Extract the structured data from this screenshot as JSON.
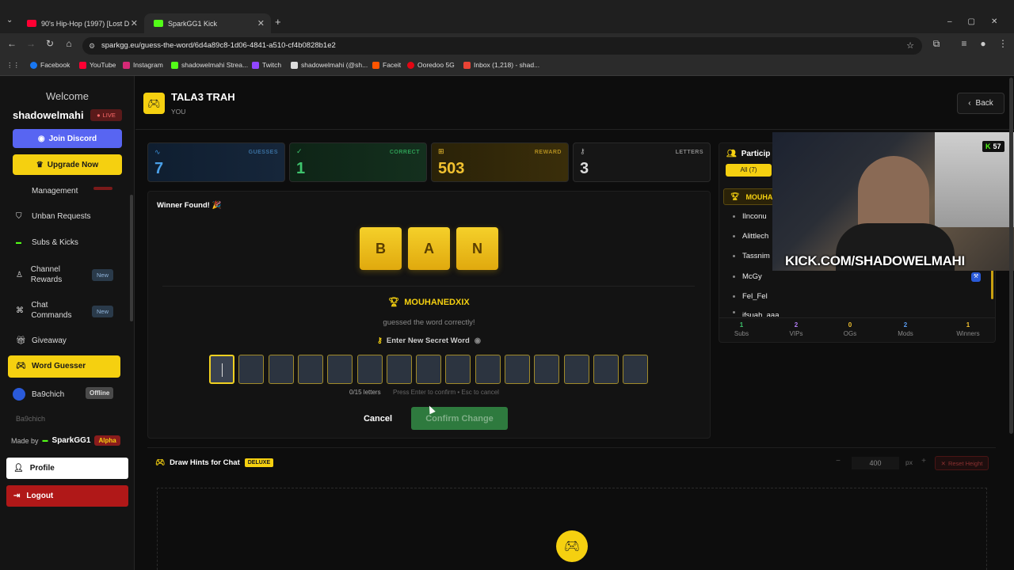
{
  "browser": {
    "tabs": [
      {
        "title": "90's Hip-Hop (1997) [Lost D",
        "active": false
      },
      {
        "title": "SparkGG1 Kick",
        "active": true
      }
    ],
    "url": "sparkgg.eu/guess-the-word/6d4a89c8-1d06-4841-a510-cf4b0828b1e2",
    "bookmarks": [
      "Facebook",
      "YouTube",
      "Instagram",
      "shadowelmahi Strea...",
      "Twitch",
      "shadowelmahi (@sh...",
      "Faceit",
      "Ooredoo 5G",
      "Inbox (1,218) - shad..."
    ]
  },
  "sidebar": {
    "welcome": "Welcome",
    "username": "shadowelmahi",
    "live_badge": "LIVE",
    "discord_button": "Join Discord",
    "upgrade_button": "Upgrade Now",
    "items": [
      {
        "label": "Management",
        "badge": ""
      },
      {
        "label": "Unban Requests",
        "badge": ""
      },
      {
        "label": "Subs & Kicks",
        "badge": ""
      },
      {
        "label": "Channel Rewards",
        "badge": "New"
      },
      {
        "label": "Chat Commands",
        "badge": "New"
      },
      {
        "label": "Giveaway",
        "badge": ""
      },
      {
        "label": "Word Guesser",
        "badge": ""
      },
      {
        "label": "Ba9chich",
        "badge": "Offline"
      },
      {
        "label": "Ba9chich",
        "badge": ""
      }
    ],
    "made_by": "Made by",
    "maker": "SparkGG1",
    "maker_badge": "Alpha",
    "profile_button": "Profile",
    "logout_button": "Logout"
  },
  "header": {
    "title": "TALA3 TRAH",
    "subtitle": "YOU",
    "back_button": "Back"
  },
  "stats": [
    {
      "label": "GUESSES",
      "value": "7",
      "color": "#3a8fd9"
    },
    {
      "label": "CORRECT",
      "value": "1",
      "color": "#3ec46d"
    },
    {
      "label": "REWARD",
      "value": "503",
      "color": "#f2c230"
    },
    {
      "label": "LETTERS",
      "value": "3",
      "color": "#aaaaaa"
    }
  ],
  "game": {
    "winner_label": "Winner Found! 🎉",
    "word_letters": [
      "B",
      "A",
      "N"
    ],
    "winner_name": "MOUHANEDXIX",
    "winner_message": "guessed the word correctly!",
    "secret_label": "Enter New Secret Word",
    "slot_count": 15,
    "letters_count": "0/15 letters",
    "hint": "Press Enter to confirm • Esc to cancel",
    "cancel_button": "Cancel",
    "confirm_button": "Confirm Change"
  },
  "participants": {
    "title": "Particip",
    "filter_all": "All (7)",
    "top": "MOUHAN",
    "rows": [
      "Ilnconu",
      "Alittlech",
      "Tassnim",
      "McGy",
      "Fel_Fel",
      "ifsuah_aaa"
    ],
    "stats": [
      {
        "value": "1",
        "label": "Subs",
        "color": "#3ec46d"
      },
      {
        "value": "2",
        "label": "VIPs",
        "color": "#b07cf0"
      },
      {
        "value": "0",
        "label": "OGs",
        "color": "#f2c230"
      },
      {
        "value": "2",
        "label": "Mods",
        "color": "#5a9cf0"
      },
      {
        "value": "1",
        "label": "Winners",
        "color": "#f2c230"
      }
    ]
  },
  "webcam": {
    "viewer_count": "57",
    "overlay_text": "KICK.COM/SHADOWELMAHI"
  },
  "hints": {
    "title": "Draw Hints for Chat",
    "badge": "DELUXE",
    "height_value": "400",
    "unit": "px",
    "reset_button": "Reset Height"
  }
}
